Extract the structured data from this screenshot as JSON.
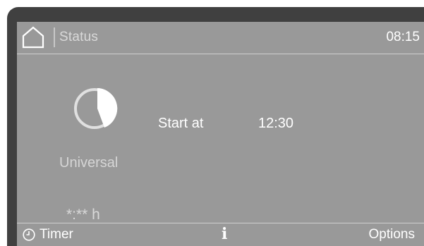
{
  "header": {
    "icon": "home-icon",
    "title": "Status",
    "time": "08:15"
  },
  "program": {
    "icon": "pie-chart-icon",
    "name": "Universal",
    "duration": "*:** h"
  },
  "start": {
    "label": "Start at",
    "time": "12:30"
  },
  "footer": {
    "timer_icon": "clock-icon",
    "timer_label": "Timer",
    "info_icon": "info-icon",
    "info_label": "i",
    "options_label": "Options"
  },
  "colors": {
    "screen_bg": "#999999",
    "bezel": "#404040",
    "text": "#ffffff"
  }
}
